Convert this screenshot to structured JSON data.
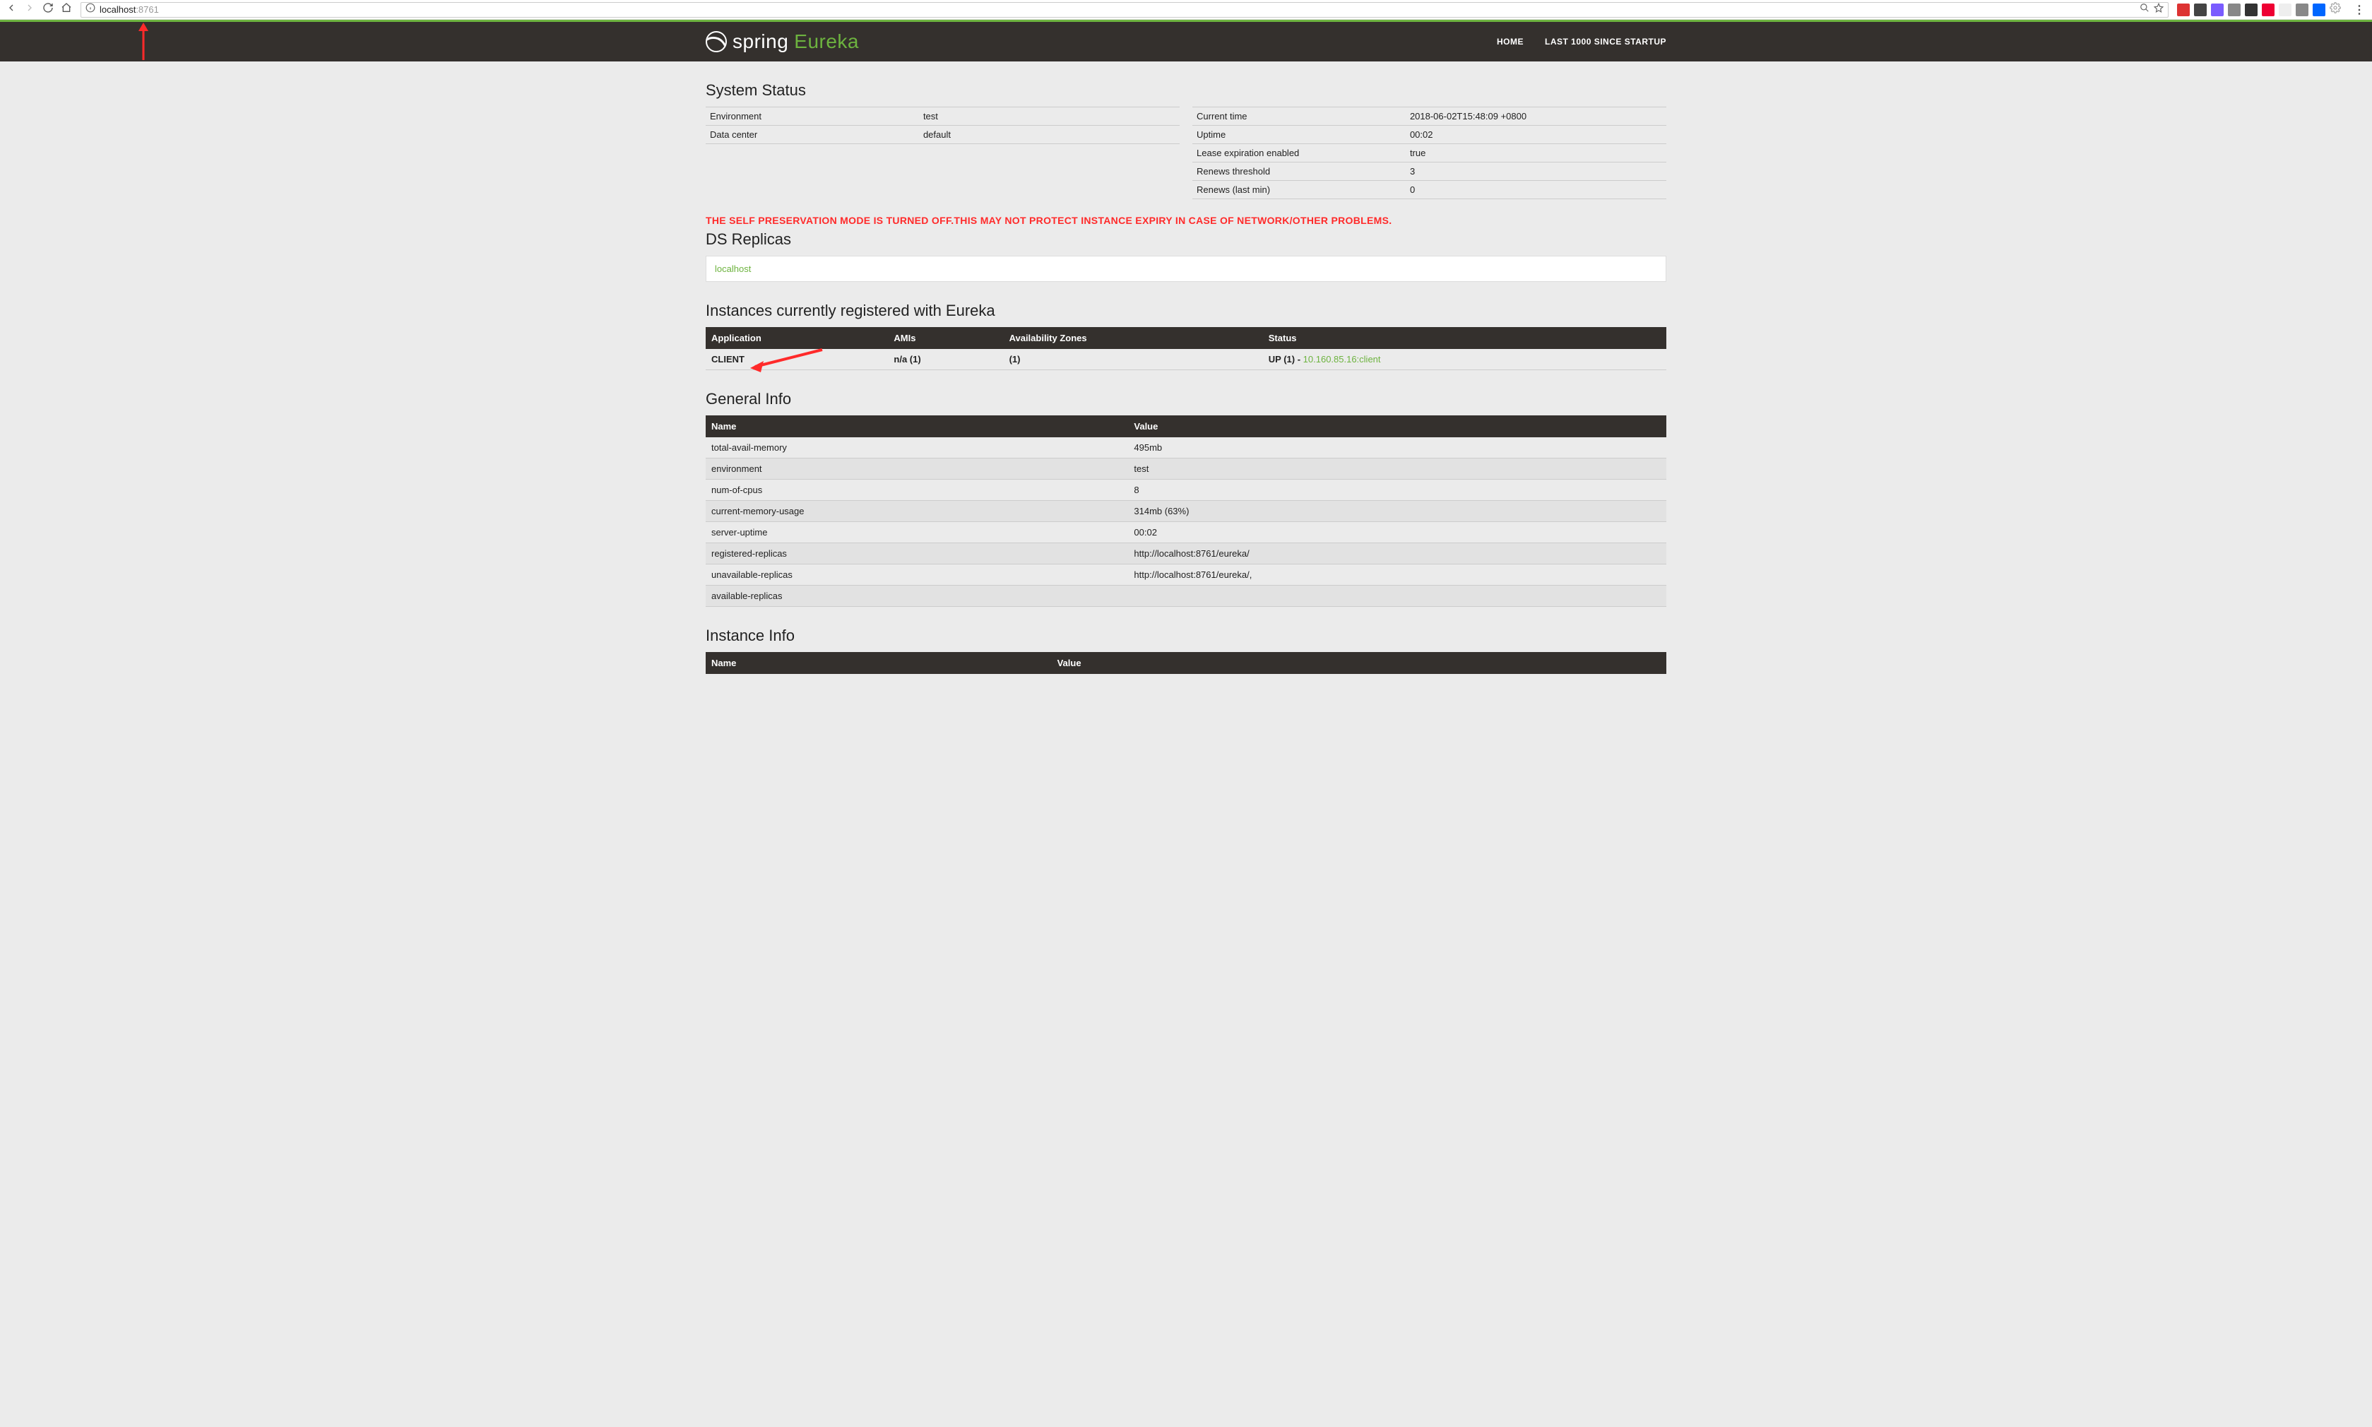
{
  "browser": {
    "url_host": "localhost",
    "url_port": ":8761"
  },
  "header": {
    "brand_a": "spring",
    "brand_b": "Eureka",
    "nav": {
      "home": "HOME",
      "last1000": "LAST 1000 SINCE STARTUP"
    }
  },
  "sections": {
    "system_status": "System Status",
    "ds_replicas": "DS Replicas",
    "instances": "Instances currently registered with Eureka",
    "general_info": "General Info",
    "instance_info": "Instance Info"
  },
  "status_left": [
    {
      "k": "Environment",
      "v": "test"
    },
    {
      "k": "Data center",
      "v": "default"
    }
  ],
  "status_right": [
    {
      "k": "Current time",
      "v": "2018-06-02T15:48:09 +0800"
    },
    {
      "k": "Uptime",
      "v": "00:02"
    },
    {
      "k": "Lease expiration enabled",
      "v": "true"
    },
    {
      "k": "Renews threshold",
      "v": "3"
    },
    {
      "k": "Renews (last min)",
      "v": "0"
    }
  ],
  "warning": "THE SELF PRESERVATION MODE IS TURNED OFF.THIS MAY NOT PROTECT INSTANCE EXPIRY IN CASE OF NETWORK/OTHER PROBLEMS.",
  "replicas": [
    "localhost"
  ],
  "instances": {
    "headers": {
      "app": "Application",
      "amis": "AMIs",
      "zones": "Availability Zones",
      "status": "Status"
    },
    "rows": [
      {
        "app": "CLIENT",
        "amis": "n/a (1)",
        "zones": "(1)",
        "status_prefix": "UP (1) - ",
        "status_link": "10.160.85.16:client"
      }
    ]
  },
  "general_info": {
    "headers": {
      "name": "Name",
      "value": "Value"
    },
    "rows": [
      {
        "k": "total-avail-memory",
        "v": "495mb"
      },
      {
        "k": "environment",
        "v": "test"
      },
      {
        "k": "num-of-cpus",
        "v": "8"
      },
      {
        "k": "current-memory-usage",
        "v": "314mb (63%)"
      },
      {
        "k": "server-uptime",
        "v": "00:02"
      },
      {
        "k": "registered-replicas",
        "v": "http://localhost:8761/eureka/"
      },
      {
        "k": "unavailable-replicas",
        "v": "http://localhost:8761/eureka/,"
      },
      {
        "k": "available-replicas",
        "v": ""
      }
    ]
  },
  "instance_info": {
    "headers": {
      "name": "Name",
      "value": "Value"
    }
  }
}
